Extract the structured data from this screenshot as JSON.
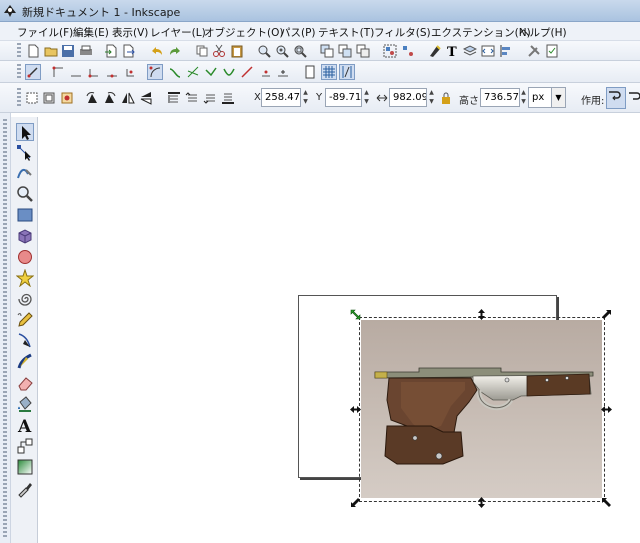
{
  "window": {
    "title": "新規ドキュメント 1 - Inkscape"
  },
  "menu": [
    "ファイル(F)",
    "編集(E)",
    "表示(V)",
    "レイヤー(L)",
    "オブジェクト(O)",
    "パス(P)",
    "テキスト(T)",
    "フィルタ(S)",
    "エクステンション(N)",
    "ヘルプ(H)"
  ],
  "toolbar_select": {
    "x_label": "X",
    "x_value": "258.476",
    "y_label": "Y",
    "y_value": "-89.714",
    "w_value": "982.095",
    "h_label": "高さ",
    "h_value": "736.571",
    "unit": "px",
    "affect_label": "作用:"
  },
  "colors": {
    "accent": "#2f5fa8",
    "selection_handle": "#111111",
    "rotate_handle": "#2aa02a"
  }
}
